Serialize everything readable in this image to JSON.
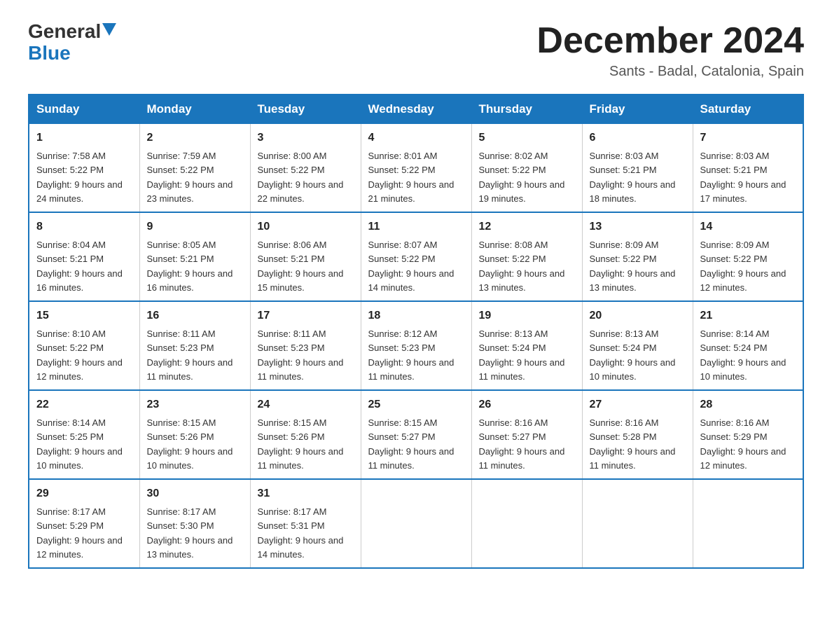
{
  "logo": {
    "general": "General",
    "blue": "Blue",
    "triangle": "▲"
  },
  "title": "December 2024",
  "subtitle": "Sants - Badal, Catalonia, Spain",
  "headers": [
    "Sunday",
    "Monday",
    "Tuesday",
    "Wednesday",
    "Thursday",
    "Friday",
    "Saturday"
  ],
  "weeks": [
    [
      {
        "day": "1",
        "sunrise": "7:58 AM",
        "sunset": "5:22 PM",
        "daylight": "9 hours and 24 minutes."
      },
      {
        "day": "2",
        "sunrise": "7:59 AM",
        "sunset": "5:22 PM",
        "daylight": "9 hours and 23 minutes."
      },
      {
        "day": "3",
        "sunrise": "8:00 AM",
        "sunset": "5:22 PM",
        "daylight": "9 hours and 22 minutes."
      },
      {
        "day": "4",
        "sunrise": "8:01 AM",
        "sunset": "5:22 PM",
        "daylight": "9 hours and 21 minutes."
      },
      {
        "day": "5",
        "sunrise": "8:02 AM",
        "sunset": "5:22 PM",
        "daylight": "9 hours and 19 minutes."
      },
      {
        "day": "6",
        "sunrise": "8:03 AM",
        "sunset": "5:21 PM",
        "daylight": "9 hours and 18 minutes."
      },
      {
        "day": "7",
        "sunrise": "8:03 AM",
        "sunset": "5:21 PM",
        "daylight": "9 hours and 17 minutes."
      }
    ],
    [
      {
        "day": "8",
        "sunrise": "8:04 AM",
        "sunset": "5:21 PM",
        "daylight": "9 hours and 16 minutes."
      },
      {
        "day": "9",
        "sunrise": "8:05 AM",
        "sunset": "5:21 PM",
        "daylight": "9 hours and 16 minutes."
      },
      {
        "day": "10",
        "sunrise": "8:06 AM",
        "sunset": "5:21 PM",
        "daylight": "9 hours and 15 minutes."
      },
      {
        "day": "11",
        "sunrise": "8:07 AM",
        "sunset": "5:22 PM",
        "daylight": "9 hours and 14 minutes."
      },
      {
        "day": "12",
        "sunrise": "8:08 AM",
        "sunset": "5:22 PM",
        "daylight": "9 hours and 13 minutes."
      },
      {
        "day": "13",
        "sunrise": "8:09 AM",
        "sunset": "5:22 PM",
        "daylight": "9 hours and 13 minutes."
      },
      {
        "day": "14",
        "sunrise": "8:09 AM",
        "sunset": "5:22 PM",
        "daylight": "9 hours and 12 minutes."
      }
    ],
    [
      {
        "day": "15",
        "sunrise": "8:10 AM",
        "sunset": "5:22 PM",
        "daylight": "9 hours and 12 minutes."
      },
      {
        "day": "16",
        "sunrise": "8:11 AM",
        "sunset": "5:23 PM",
        "daylight": "9 hours and 11 minutes."
      },
      {
        "day": "17",
        "sunrise": "8:11 AM",
        "sunset": "5:23 PM",
        "daylight": "9 hours and 11 minutes."
      },
      {
        "day": "18",
        "sunrise": "8:12 AM",
        "sunset": "5:23 PM",
        "daylight": "9 hours and 11 minutes."
      },
      {
        "day": "19",
        "sunrise": "8:13 AM",
        "sunset": "5:24 PM",
        "daylight": "9 hours and 11 minutes."
      },
      {
        "day": "20",
        "sunrise": "8:13 AM",
        "sunset": "5:24 PM",
        "daylight": "9 hours and 10 minutes."
      },
      {
        "day": "21",
        "sunrise": "8:14 AM",
        "sunset": "5:24 PM",
        "daylight": "9 hours and 10 minutes."
      }
    ],
    [
      {
        "day": "22",
        "sunrise": "8:14 AM",
        "sunset": "5:25 PM",
        "daylight": "9 hours and 10 minutes."
      },
      {
        "day": "23",
        "sunrise": "8:15 AM",
        "sunset": "5:26 PM",
        "daylight": "9 hours and 10 minutes."
      },
      {
        "day": "24",
        "sunrise": "8:15 AM",
        "sunset": "5:26 PM",
        "daylight": "9 hours and 11 minutes."
      },
      {
        "day": "25",
        "sunrise": "8:15 AM",
        "sunset": "5:27 PM",
        "daylight": "9 hours and 11 minutes."
      },
      {
        "day": "26",
        "sunrise": "8:16 AM",
        "sunset": "5:27 PM",
        "daylight": "9 hours and 11 minutes."
      },
      {
        "day": "27",
        "sunrise": "8:16 AM",
        "sunset": "5:28 PM",
        "daylight": "9 hours and 11 minutes."
      },
      {
        "day": "28",
        "sunrise": "8:16 AM",
        "sunset": "5:29 PM",
        "daylight": "9 hours and 12 minutes."
      }
    ],
    [
      {
        "day": "29",
        "sunrise": "8:17 AM",
        "sunset": "5:29 PM",
        "daylight": "9 hours and 12 minutes."
      },
      {
        "day": "30",
        "sunrise": "8:17 AM",
        "sunset": "5:30 PM",
        "daylight": "9 hours and 13 minutes."
      },
      {
        "day": "31",
        "sunrise": "8:17 AM",
        "sunset": "5:31 PM",
        "daylight": "9 hours and 14 minutes."
      },
      null,
      null,
      null,
      null
    ]
  ]
}
